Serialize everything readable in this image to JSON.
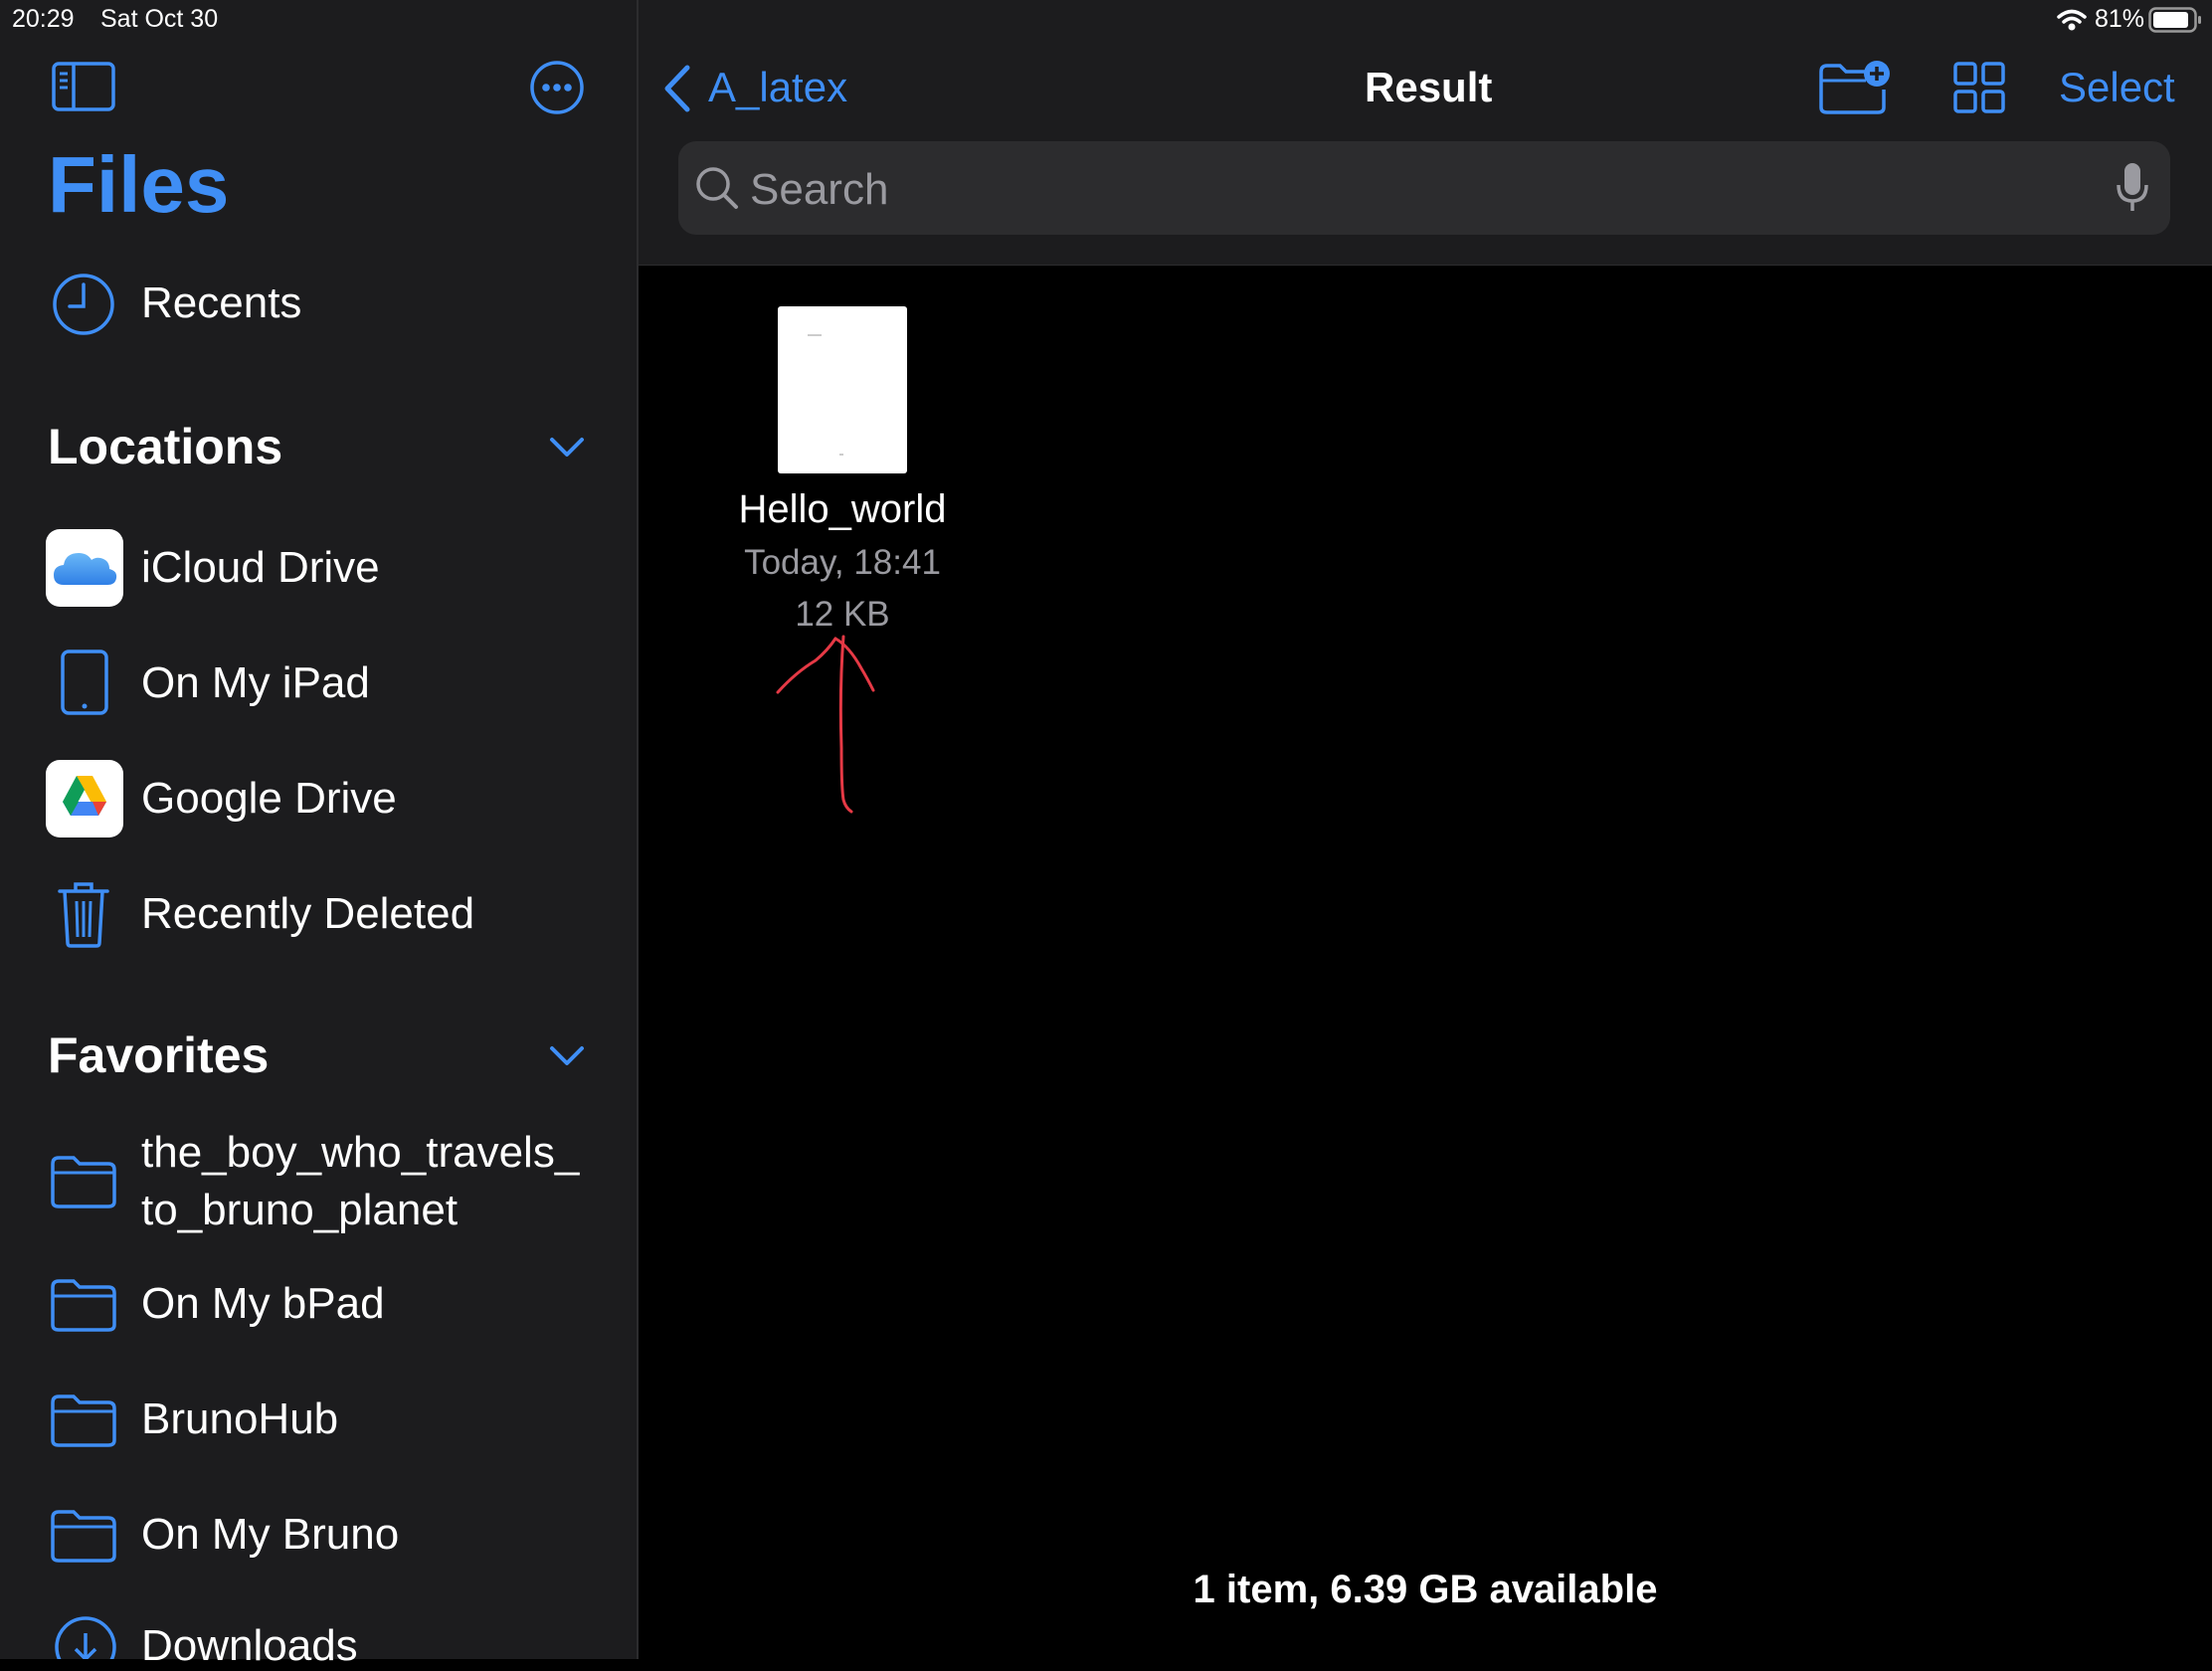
{
  "status_bar": {
    "time": "20:29",
    "date": "Sat Oct 30",
    "battery": "81%"
  },
  "sidebar": {
    "title": "Files",
    "recents": "Recents",
    "locations_header": "Locations",
    "locations": [
      {
        "label": "iCloud Drive",
        "icon": "icloud-icon"
      },
      {
        "label": "On My iPad",
        "icon": "ipad-icon"
      },
      {
        "label": "Google Drive",
        "icon": "google-drive-icon"
      },
      {
        "label": "Recently Deleted",
        "icon": "trash-icon"
      }
    ],
    "favorites_header": "Favorites",
    "favorites": [
      {
        "label_line1": "the_boy_who_travels_",
        "label_line2": "to_bruno_planet",
        "icon": "folder-icon"
      },
      {
        "label": "On My bPad",
        "icon": "folder-icon"
      },
      {
        "label": "BrunoHub",
        "icon": "folder-icon"
      },
      {
        "label": "On My Bruno",
        "icon": "folder-icon"
      },
      {
        "label": "Downloads",
        "icon": "download-icon"
      }
    ]
  },
  "toolbar": {
    "back_label": "A_latex",
    "title": "Result",
    "select_label": "Select"
  },
  "search": {
    "placeholder": "Search"
  },
  "file": {
    "name": "Hello_world",
    "date": "Today, 18:41",
    "size": "12 KB"
  },
  "footer": {
    "summary": "1 item, 6.39 GB available"
  },
  "colors": {
    "accent": "#3f8ef5",
    "sidebar_bg": "#1c1c1e",
    "annotation": "#e53945"
  }
}
